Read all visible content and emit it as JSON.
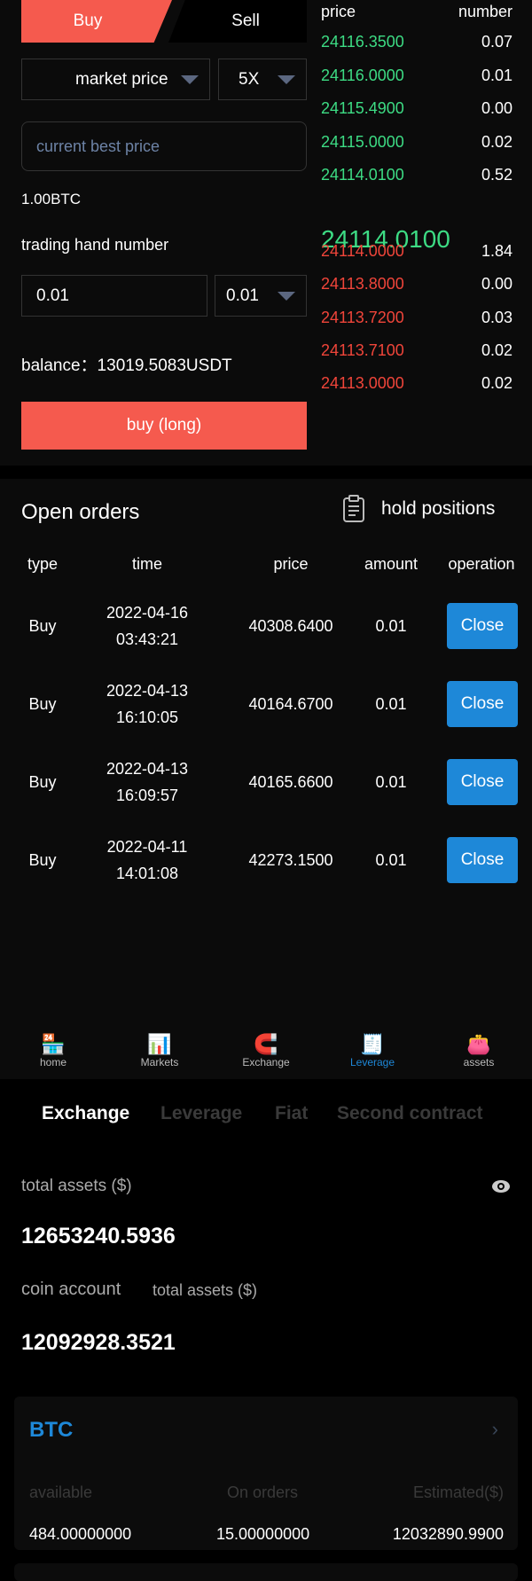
{
  "trade": {
    "buy_tab": "Buy",
    "sell_tab": "Sell",
    "order_type": "market price",
    "leverage": "5X",
    "price_placeholder": "current best price",
    "amount_btc": "1.00BTC",
    "hand_label": "trading hand number",
    "hand_value": "0.01",
    "hand_select": "0.01",
    "balance": "balance：13019.5083USDT",
    "buy_button": "buy (long)"
  },
  "orderbook": {
    "col_price": "price",
    "col_number": "number",
    "asks": [
      {
        "price": "24116.3500",
        "number": "0.07"
      },
      {
        "price": "24116.0000",
        "number": "0.01"
      },
      {
        "price": "24115.4900",
        "number": "0.00"
      },
      {
        "price": "24115.0000",
        "number": "0.02"
      },
      {
        "price": "24114.0100",
        "number": "0.52"
      }
    ],
    "last_price": "24114.0100",
    "bids": [
      {
        "price": "24114.0000",
        "number": "1.84"
      },
      {
        "price": "24113.8000",
        "number": "0.00"
      },
      {
        "price": "24113.7200",
        "number": "0.03"
      },
      {
        "price": "24113.7100",
        "number": "0.02"
      },
      {
        "price": "24113.0000",
        "number": "0.02"
      }
    ],
    "colors": {
      "up": "#3ddc84",
      "down": "#f0453a"
    }
  },
  "orders": {
    "title": "Open orders",
    "hold_positions": "hold positions",
    "headers": [
      "type",
      "time",
      "price",
      "amount",
      "operation"
    ],
    "rows": [
      {
        "type": "Buy",
        "date": "2022-04-16",
        "time": "03:43:21",
        "price": "40308.6400",
        "amount": "0.01",
        "action": "Close"
      },
      {
        "type": "Buy",
        "date": "2022-04-13",
        "time": "16:10:05",
        "price": "40164.6700",
        "amount": "0.01",
        "action": "Close"
      },
      {
        "type": "Buy",
        "date": "2022-04-13",
        "time": "16:09:57",
        "price": "40165.6600",
        "amount": "0.01",
        "action": "Close"
      },
      {
        "type": "Buy",
        "date": "2022-04-11",
        "time": "14:01:08",
        "price": "42273.1500",
        "amount": "0.01",
        "action": "Close"
      }
    ]
  },
  "nav": {
    "items": [
      {
        "label": "home",
        "icon": "shop-icon"
      },
      {
        "label": "Markets",
        "icon": "chart-icon"
      },
      {
        "label": "Exchange",
        "icon": "magnet-icon"
      },
      {
        "label": "Leverage",
        "icon": "receipt-icon",
        "active": true
      },
      {
        "label": "assets",
        "icon": "wallet-icon"
      }
    ],
    "active_color": "#1e88d8"
  },
  "assets": {
    "tabs": [
      "Exchange",
      "Leverage",
      "Fiat",
      "Second contract"
    ],
    "total_label": "total assets  ($)",
    "total_value": "12653240.5936",
    "coin_label": "coin account",
    "coin_total_label": "total assets  ($)",
    "coin_value": "12092928.3521",
    "card": {
      "coin": "BTC",
      "available_label": "available",
      "on_orders_label": "On orders",
      "estimated_label": "Estimated($)",
      "available": "484.00000000",
      "on_orders": "15.00000000",
      "estimated": "12032890.9900"
    }
  }
}
